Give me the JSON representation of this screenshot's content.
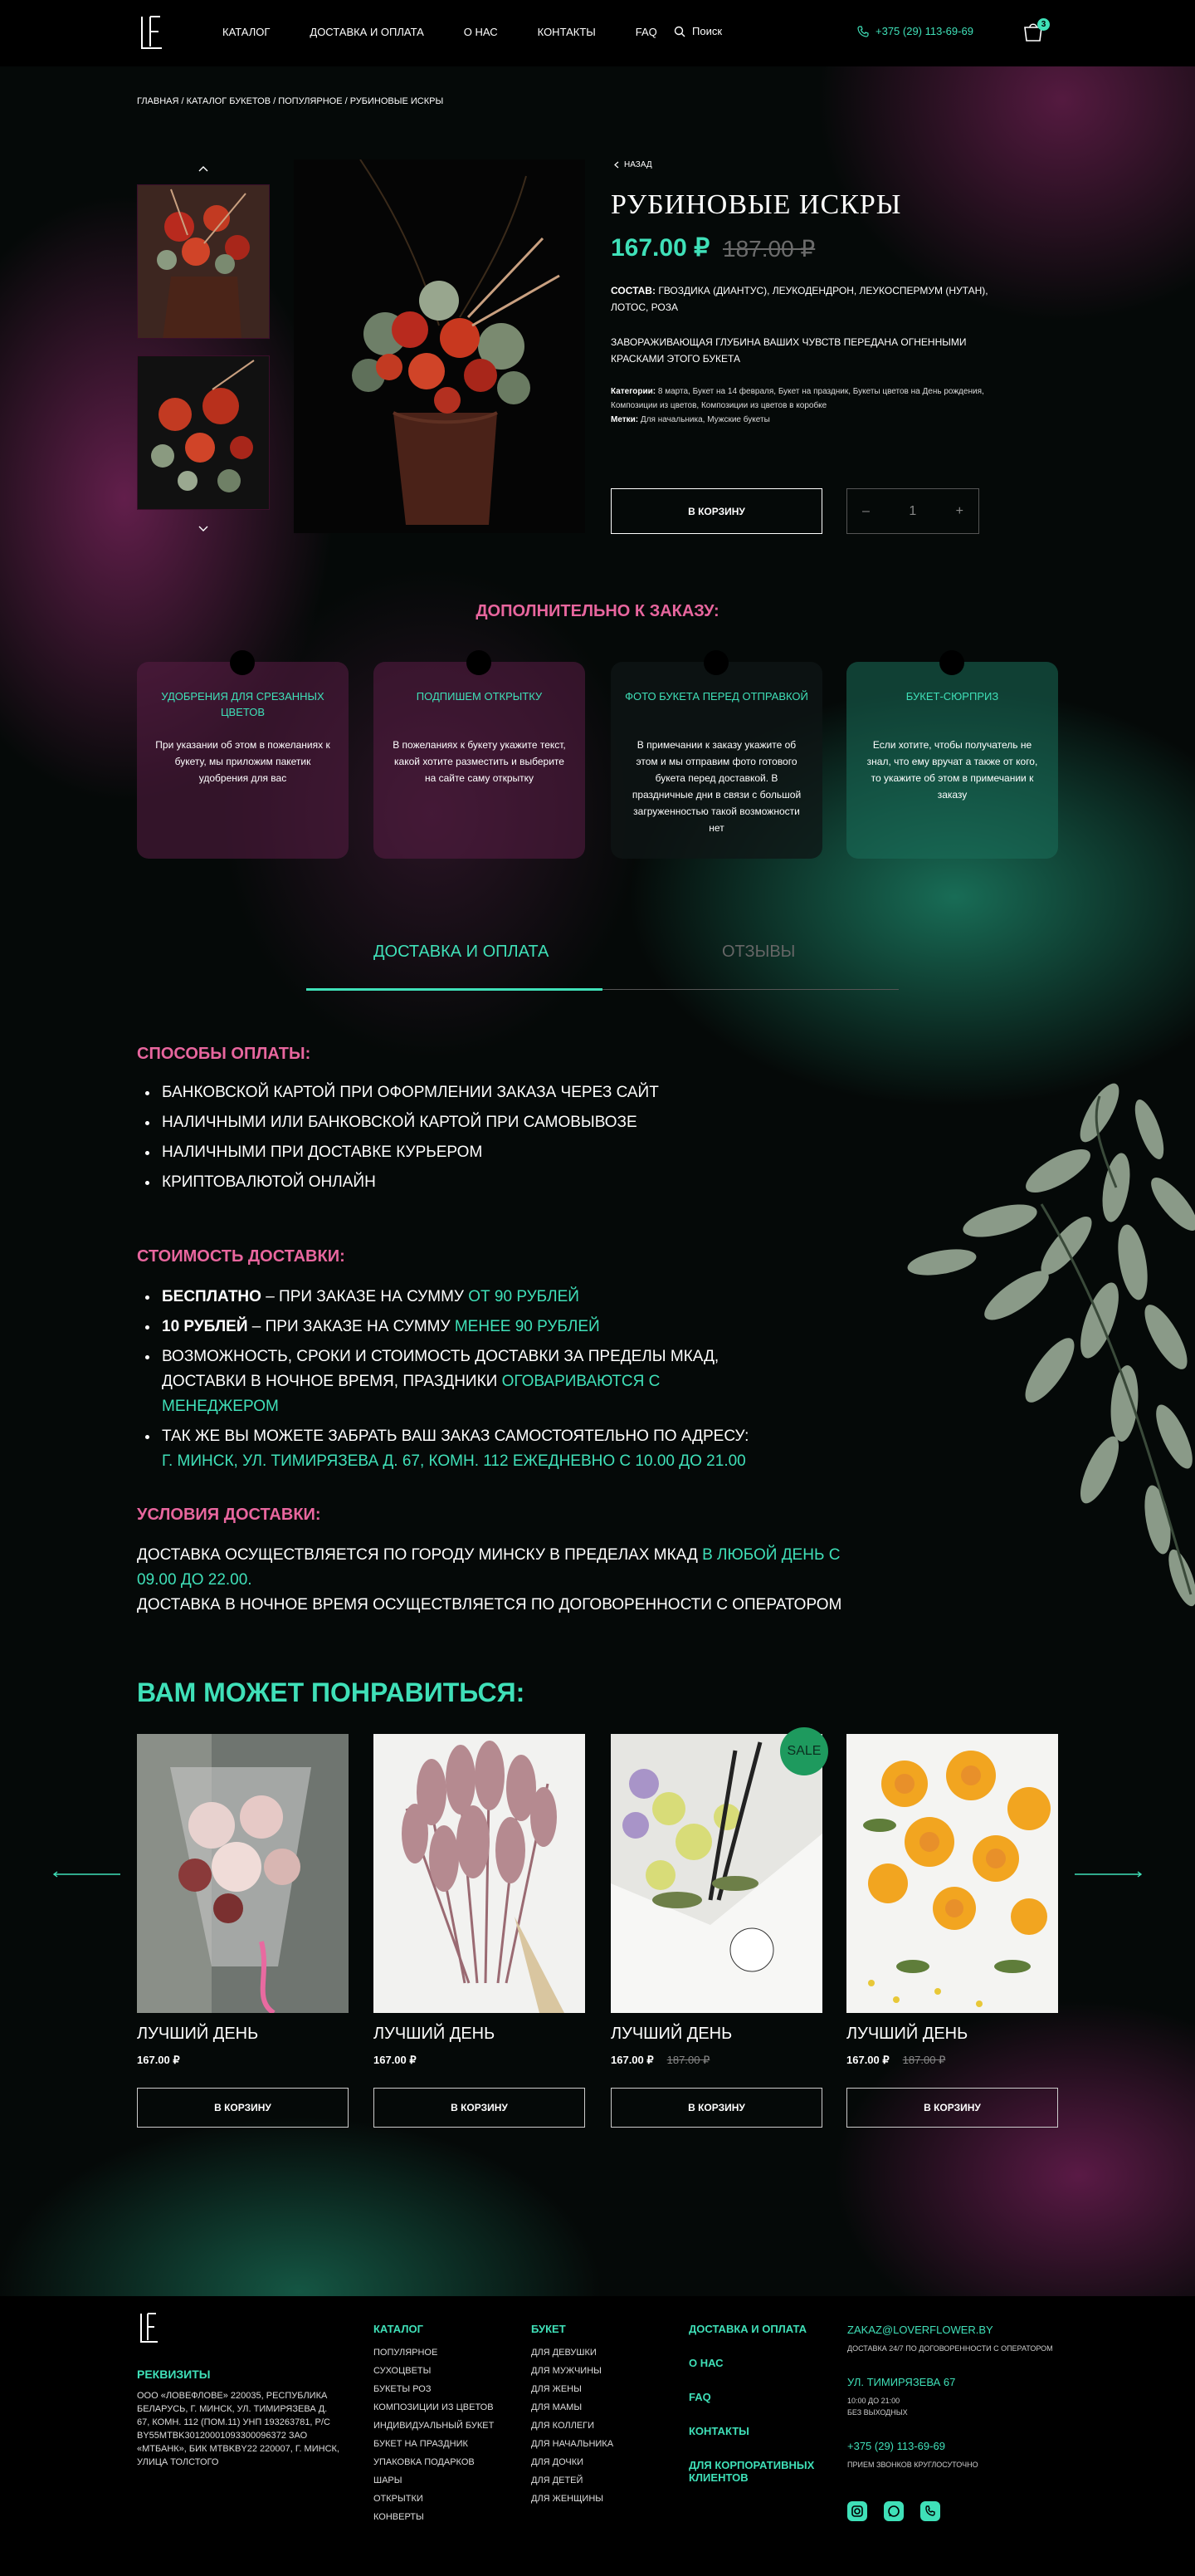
{
  "header": {
    "nav": [
      "Каталог",
      "Доставка и оплата",
      "О нас",
      "Контакты",
      "FAQ"
    ],
    "search_label": "Поиск",
    "phone": "+375 (29) 113-69-69",
    "cart_count": "3"
  },
  "breadcrumbs": "Главная / Каталог букетов / Популярное / Рубиновые искры",
  "product": {
    "back_label": "Назад",
    "title": "РУБИНОВЫЕ ИСКРЫ",
    "price": "167.00 ₽",
    "old_price": "187.00 ₽",
    "composition_label": "Состав:",
    "composition": "гвоздика (диантус), леукодендрон, леукоспермум (нутан), лотос, роза",
    "description": "Завораживающая глубина ваших чувств передана огненными красками этого букета",
    "categories_label": "Категории:",
    "categories": "8 марта, Букет на 14 февраля, Букет на праздник, Букеты цветов на День рождения, Композиции из цветов, Композиции из цветов в коробке",
    "tags_label": "Метки:",
    "tags": "Для начальника, Мужские букеты",
    "add_to_cart": "В корзину",
    "qty_minus": "–",
    "qty_value": "1",
    "qty_plus": "+"
  },
  "extras": {
    "heading": "Дополнительно к заказу:",
    "cards": [
      {
        "title": "Удобрения для срезанных цветов",
        "text": "При указании об этом в пожеланиях к букету, мы приложим пакетик удобрения для вас"
      },
      {
        "title": "Подпишем открытку",
        "text": "В пожеланиях к букету укажите текст, какой хотите разместить и выберите на сайте саму открытку"
      },
      {
        "title": "Фото букета перед отправкой",
        "text": "В примечании к заказу укажите об этом и мы отправим фото готового букета перед доставкой. В праздничные дни в связи с большой загруженностью такой возможности нет"
      },
      {
        "title": "Букет-сюрприз",
        "text": "Если хотите, чтобы получатель не знал, что ему вручат а также от кого, то укажите об этом в примечании к заказу"
      }
    ]
  },
  "tabs": {
    "active": "Доставка и оплата",
    "inactive": "Отзывы"
  },
  "payment": {
    "heading": "Способы оплаты:",
    "items": [
      "Банковской картой при оформлении заказа через сайт",
      "Наличными или банковской картой при самовывозе",
      "Наличными при доставке курьером",
      "Криптовалютой онлайн"
    ]
  },
  "delivery_cost": {
    "heading": "Стоимость доставки:",
    "free_b": "Бесплатно",
    "free_t": " – при заказе на сумму ",
    "free_h": "от 90 рублей",
    "paid_b": "10 рублей",
    "paid_t": " – при заказе на сумму ",
    "paid_h": "менее 90 рублей",
    "outside_t": "Возможность, сроки и стоимость доставки за пределы МКАД, доставки в ночное время, праздники ",
    "outside_h": "оговариваются с менеджером",
    "pickup_t": "Так же вы можете забрать ваш заказ самостоятельно по адресу:",
    "pickup_h": "г. Минск, ул. Тимирязева д. 67, комн. 112 ежедневно с 10.00 до 21.00"
  },
  "delivery_terms": {
    "heading": "Условия доставки:",
    "line1_t": "Доставка осуществляется по городу Минску в пределах МКАД ",
    "line1_h": "в любой день с 09.00 до 22.00.",
    "line2": "Доставка в ночное время осуществляется по договоренности с оператором"
  },
  "recommend": {
    "heading": "Вам может понравиться:",
    "sale_label": "SALE",
    "products": [
      {
        "name": "Лучший день",
        "price": "167.00 ₽",
        "old_price": "",
        "button": "В корзину"
      },
      {
        "name": "Лучший день",
        "price": "167.00 ₽",
        "old_price": "",
        "button": "В корзину"
      },
      {
        "name": "Лучший день",
        "price": "167.00 ₽",
        "old_price": "187.00 ₽",
        "button": "В корзину"
      },
      {
        "name": "Лучший день",
        "price": "167.00 ₽",
        "old_price": "187.00 ₽",
        "button": "В корзину"
      }
    ]
  },
  "footer": {
    "requisites_heading": "Реквизиты",
    "requisites": "ООО «ЛОВЕФЛОВЕ» 220035, Республика Беларусь, г. Минск, ул. Тимирязева д. 67, комн. 112 (пом.11) УНП 193263781, Р/С BY55MTBK30120001093300096372 ЗАО «МТБанк», БИК MTBKBY22 220007, г. Минск, улица Толстого",
    "catalog_heading": "Каталог",
    "catalog": [
      "Популярное",
      "Сухоцветы",
      "Букеты роз",
      "Композиции из цветов",
      "Индивидуальный букет",
      "Букет на праздник",
      "Упаковка подарков",
      "Шары",
      "Открытки",
      "Конверты"
    ],
    "bouquet_heading": "Букет",
    "bouquet": [
      "Для девушки",
      "Для мужчины",
      "Для жены",
      "Для мамы",
      "Для коллеги",
      "Для начальника",
      "Для дочки",
      "Для детей",
      "Для женщины"
    ],
    "links": [
      "Доставка и оплата",
      "О нас",
      "FAQ",
      "Контакты",
      "Для корпоративных клиентов"
    ],
    "email": "zakaz@loverflower.by",
    "email_note": "Доставка 24/7 по договоренности с оператором",
    "address": "ул. Тимирязева 67",
    "address_note1": "10:00 до 21:00",
    "address_note2": "без выходных",
    "phone": "+375 (29) 113-69-69",
    "phone_note": "прием звонков круглосуточно"
  }
}
